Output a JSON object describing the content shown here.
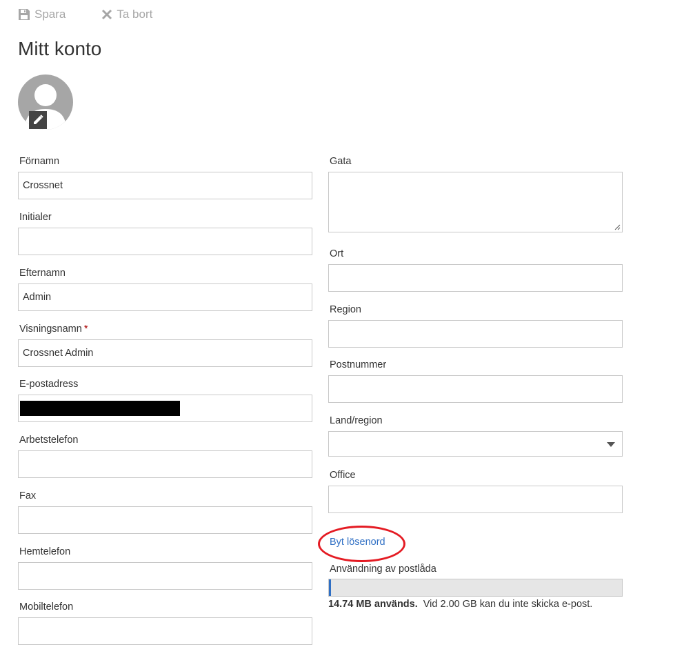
{
  "toolbar": {
    "save_label": "Spara",
    "delete_label": "Ta bort",
    "save_icon": "floppy-disk-icon",
    "delete_icon": "x-icon"
  },
  "page": {
    "title": "Mitt konto"
  },
  "avatar": {
    "icon": "person-icon",
    "edit_icon": "pencil-icon"
  },
  "left_fields": [
    {
      "label": "Förnamn",
      "value": "Crossnet"
    },
    {
      "label": "Initialer",
      "value": ""
    },
    {
      "label": "Efternamn",
      "value": "Admin"
    },
    {
      "label": "Visningsnamn",
      "required_mark": "*",
      "value": "Crossnet Admin"
    },
    {
      "label": "E-postadress",
      "value": "",
      "redacted": true
    },
    {
      "label": "Arbetstelefon",
      "value": ""
    },
    {
      "label": "Fax",
      "value": ""
    },
    {
      "label": "Hemtelefon",
      "value": ""
    },
    {
      "label": "Mobiltelefon",
      "value": ""
    }
  ],
  "right_fields": [
    {
      "label": "Gata",
      "value": "",
      "type": "textarea"
    },
    {
      "label": "Ort",
      "value": ""
    },
    {
      "label": "Region",
      "value": ""
    },
    {
      "label": "Postnummer",
      "value": ""
    },
    {
      "label": "Land/region",
      "value": "",
      "type": "select"
    },
    {
      "label": "Office",
      "value": ""
    }
  ],
  "password_link": "Byt lösenord",
  "mailbox": {
    "label": "Användning av postlåda",
    "used": "14.74 MB används.",
    "limit_text": "Vid 2.00 GB kan du inte skicka e-post.",
    "used_fraction": 0.007
  },
  "colors": {
    "link": "#2f6fc4",
    "highlight_circle": "#e41b23",
    "required": "#a80000"
  }
}
